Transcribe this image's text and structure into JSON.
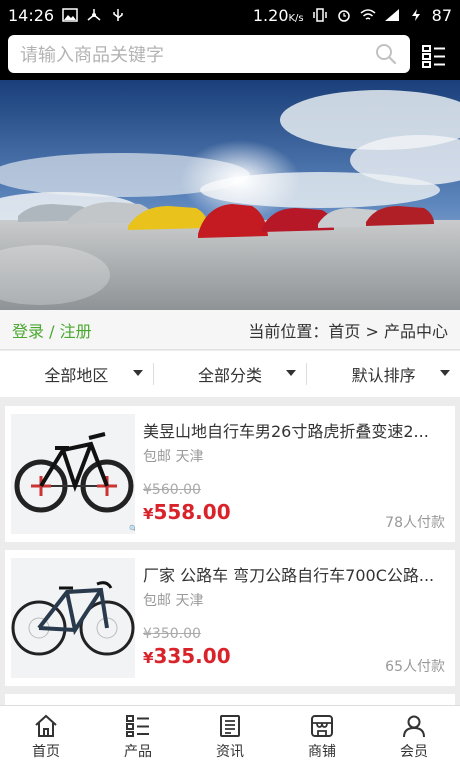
{
  "status_bar": {
    "time": "14:26",
    "speed": "1.20",
    "speed_unit": "K/s",
    "battery": "87"
  },
  "search": {
    "placeholder": "请输入商品关键字"
  },
  "auth": {
    "login": "登录",
    "sep": " / ",
    "register": "注册"
  },
  "breadcrumb": {
    "prefix": "当前位置：",
    "home": "首页",
    "arrow": " > ",
    "current": "产品中心"
  },
  "filters": [
    {
      "label": "全部地区"
    },
    {
      "label": "全部分类"
    },
    {
      "label": "默认排序"
    }
  ],
  "products": [
    {
      "title": "美昱山地自行车男26寸路虎折叠变速2...",
      "tag": "包邮 天津",
      "old_price": "¥560.00",
      "currency": "¥",
      "price": "558.00",
      "paid": "78人付款"
    },
    {
      "title": "厂家 公路车 弯刀公路自行车700C公路...",
      "tag": "包邮 天津",
      "old_price": "¥350.00",
      "currency": "¥",
      "price": "335.00",
      "paid": "65人付款"
    }
  ],
  "bottom_nav": [
    {
      "label": "首页",
      "icon": "home-icon"
    },
    {
      "label": "产品",
      "icon": "list-icon"
    },
    {
      "label": "资讯",
      "icon": "news-icon"
    },
    {
      "label": "商铺",
      "icon": "store-icon"
    },
    {
      "label": "会员",
      "icon": "user-icon"
    }
  ],
  "colors": {
    "accent_green": "#4aa82f",
    "price_red": "#d9232a"
  }
}
